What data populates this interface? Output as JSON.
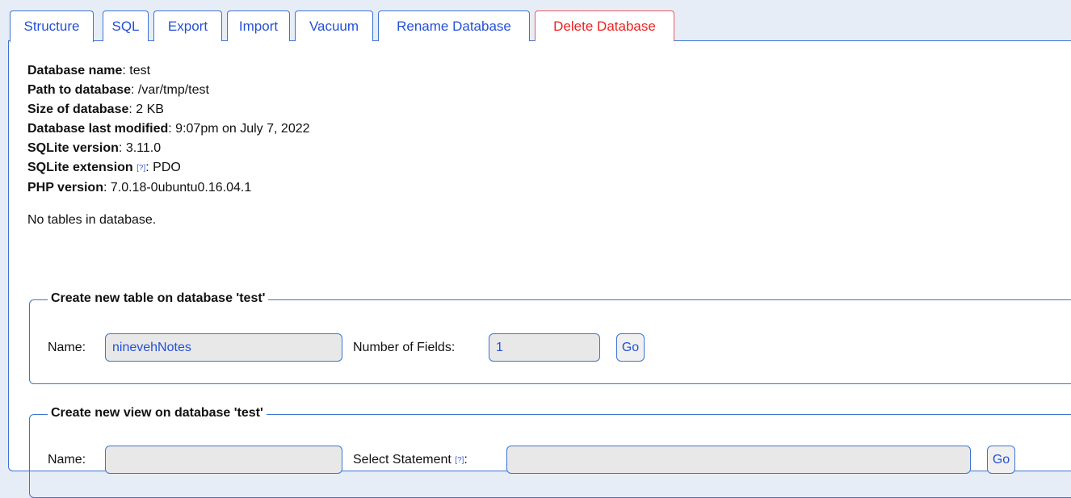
{
  "tabs": [
    {
      "label": "Structure"
    },
    {
      "label": "SQL"
    },
    {
      "label": "Export"
    },
    {
      "label": "Import"
    },
    {
      "label": "Vacuum"
    },
    {
      "label": "Rename Database"
    },
    {
      "label": "Delete Database"
    }
  ],
  "info": {
    "db_name_label": "Database name",
    "db_name_value": "test",
    "path_label": "Path to database",
    "path_value": "/var/tmp/test",
    "size_label": "Size of database",
    "size_value": "2 KB",
    "modified_label": "Database last modified",
    "modified_value": "9:07pm on July 7, 2022",
    "sqlite_version_label": "SQLite version",
    "sqlite_version_value": "3.11.0",
    "sqlite_ext_label": "SQLite extension",
    "sqlite_ext_help": "[?]",
    "sqlite_ext_value": "PDO",
    "php_version_label": "PHP version",
    "php_version_value": "7.0.18-0ubuntu0.16.04.1"
  },
  "no_tables_text": "No tables in database.",
  "create_table": {
    "legend": "Create new table on database 'test'",
    "name_label": "Name:",
    "name_value": "ninevehNotes",
    "fields_label": "Number of Fields:",
    "fields_value": "1",
    "go_label": "Go"
  },
  "create_view": {
    "legend": "Create new view on database 'test'",
    "name_label": "Name:",
    "name_value": "",
    "select_label": "Select Statement",
    "select_help": "[?]",
    "select_value": "",
    "go_label": "Go"
  },
  "colors": {
    "accent": "#3e73d4",
    "link": "#2450d6",
    "danger": "#ee2020",
    "background": "#e6edf7"
  }
}
